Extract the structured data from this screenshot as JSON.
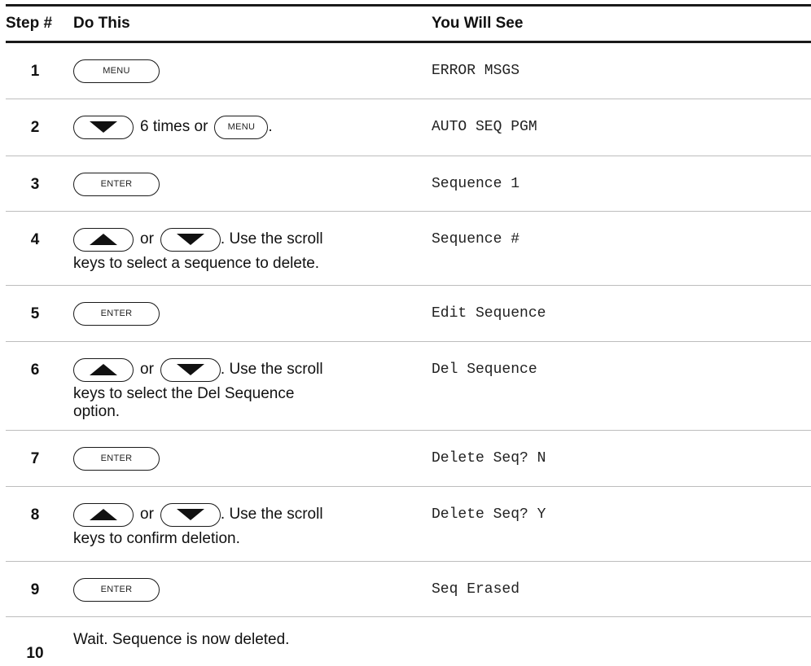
{
  "header": {
    "step": "Step #",
    "do_this": "Do This",
    "you_will_see": "You Will See"
  },
  "keys": {
    "menu": "MENU",
    "enter": "ENTER",
    "up": "up-arrow-icon",
    "down": "down-arrow-icon"
  },
  "rows": [
    {
      "step": "1",
      "see": "ERROR MSGS"
    },
    {
      "step": "2",
      "text_after_down": "6 times or",
      "text_end": ".",
      "see": "AUTO SEQ PGM"
    },
    {
      "step": "3",
      "see": "Sequence 1"
    },
    {
      "step": "4",
      "or": "or",
      "after": ". Use the scroll",
      "desc": "keys to select a sequence to delete.",
      "see": "Sequence #"
    },
    {
      "step": "5",
      "see": "Edit Sequence"
    },
    {
      "step": "6",
      "or": "or",
      "after": ". Use the scroll",
      "desc_1": "keys to select the Del Sequence",
      "desc_2": "option.",
      "see": "Del Sequence"
    },
    {
      "step": "7",
      "see": "Delete Seq? N"
    },
    {
      "step": "8",
      "or": "or",
      "after": ". Use the scroll",
      "desc": "keys to confirm deletion.",
      "see": "Delete Seq? Y"
    },
    {
      "step": "9",
      "see": "Seq Erased"
    },
    {
      "step": "10",
      "desc": "Wait. Sequence is now deleted."
    }
  ]
}
